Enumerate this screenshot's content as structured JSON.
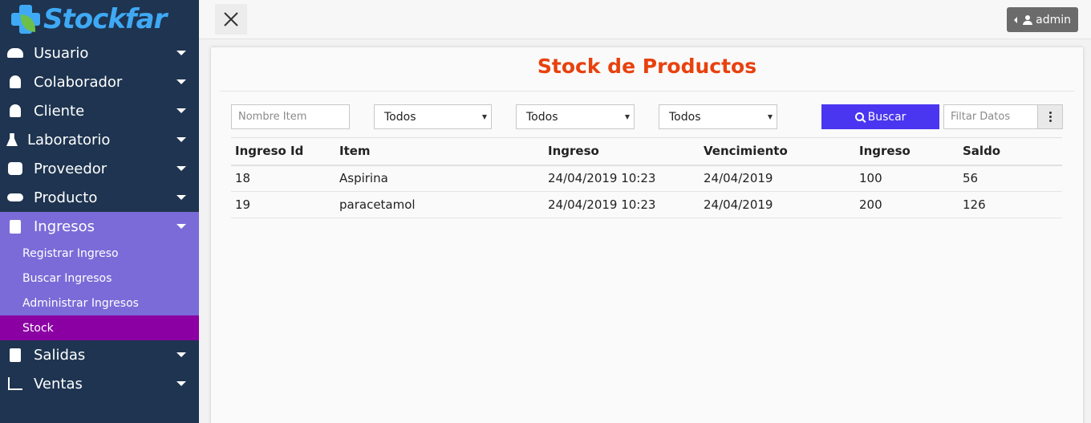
{
  "app": {
    "name": "Stockfar"
  },
  "topbar": {
    "user_label": "admin"
  },
  "sidebar": {
    "items": [
      {
        "label": "Usuario",
        "icon": "users-icon"
      },
      {
        "label": "Colaborador",
        "icon": "person-icon"
      },
      {
        "label": "Cliente",
        "icon": "user-edit-icon"
      },
      {
        "label": "Laboratorio",
        "icon": "flask-icon"
      },
      {
        "label": "Proveedor",
        "icon": "bus-icon"
      },
      {
        "label": "Producto",
        "icon": "pills-icon"
      },
      {
        "label": "Ingresos",
        "icon": "clipboard-plus-icon"
      },
      {
        "label": "Salidas",
        "icon": "clipboard-minus-icon"
      },
      {
        "label": "Ventas",
        "icon": "chart-line-icon"
      }
    ],
    "ingresos_sub": [
      {
        "label": "Registrar Ingreso"
      },
      {
        "label": "Buscar Ingresos"
      },
      {
        "label": "Administrar Ingresos"
      },
      {
        "label": "Stock"
      }
    ]
  },
  "main": {
    "title": "Stock de Productos",
    "filters": {
      "item_placeholder": "Nombre Item",
      "select1": "Todos",
      "select2": "Todos",
      "select3": "Todos",
      "search_label": "Buscar",
      "filter_placeholder": "Filtar Datos"
    },
    "table": {
      "headers": [
        "Ingreso Id",
        "Item",
        "Ingreso",
        "Vencimiento",
        "Ingreso",
        "Saldo"
      ],
      "rows": [
        [
          "18",
          "Aspirina",
          "24/04/2019 10:23",
          "24/04/2019",
          "100",
          "56"
        ],
        [
          "19",
          "paracetamol",
          "24/04/2019 10:23",
          "24/04/2019",
          "200",
          "126"
        ]
      ]
    }
  }
}
